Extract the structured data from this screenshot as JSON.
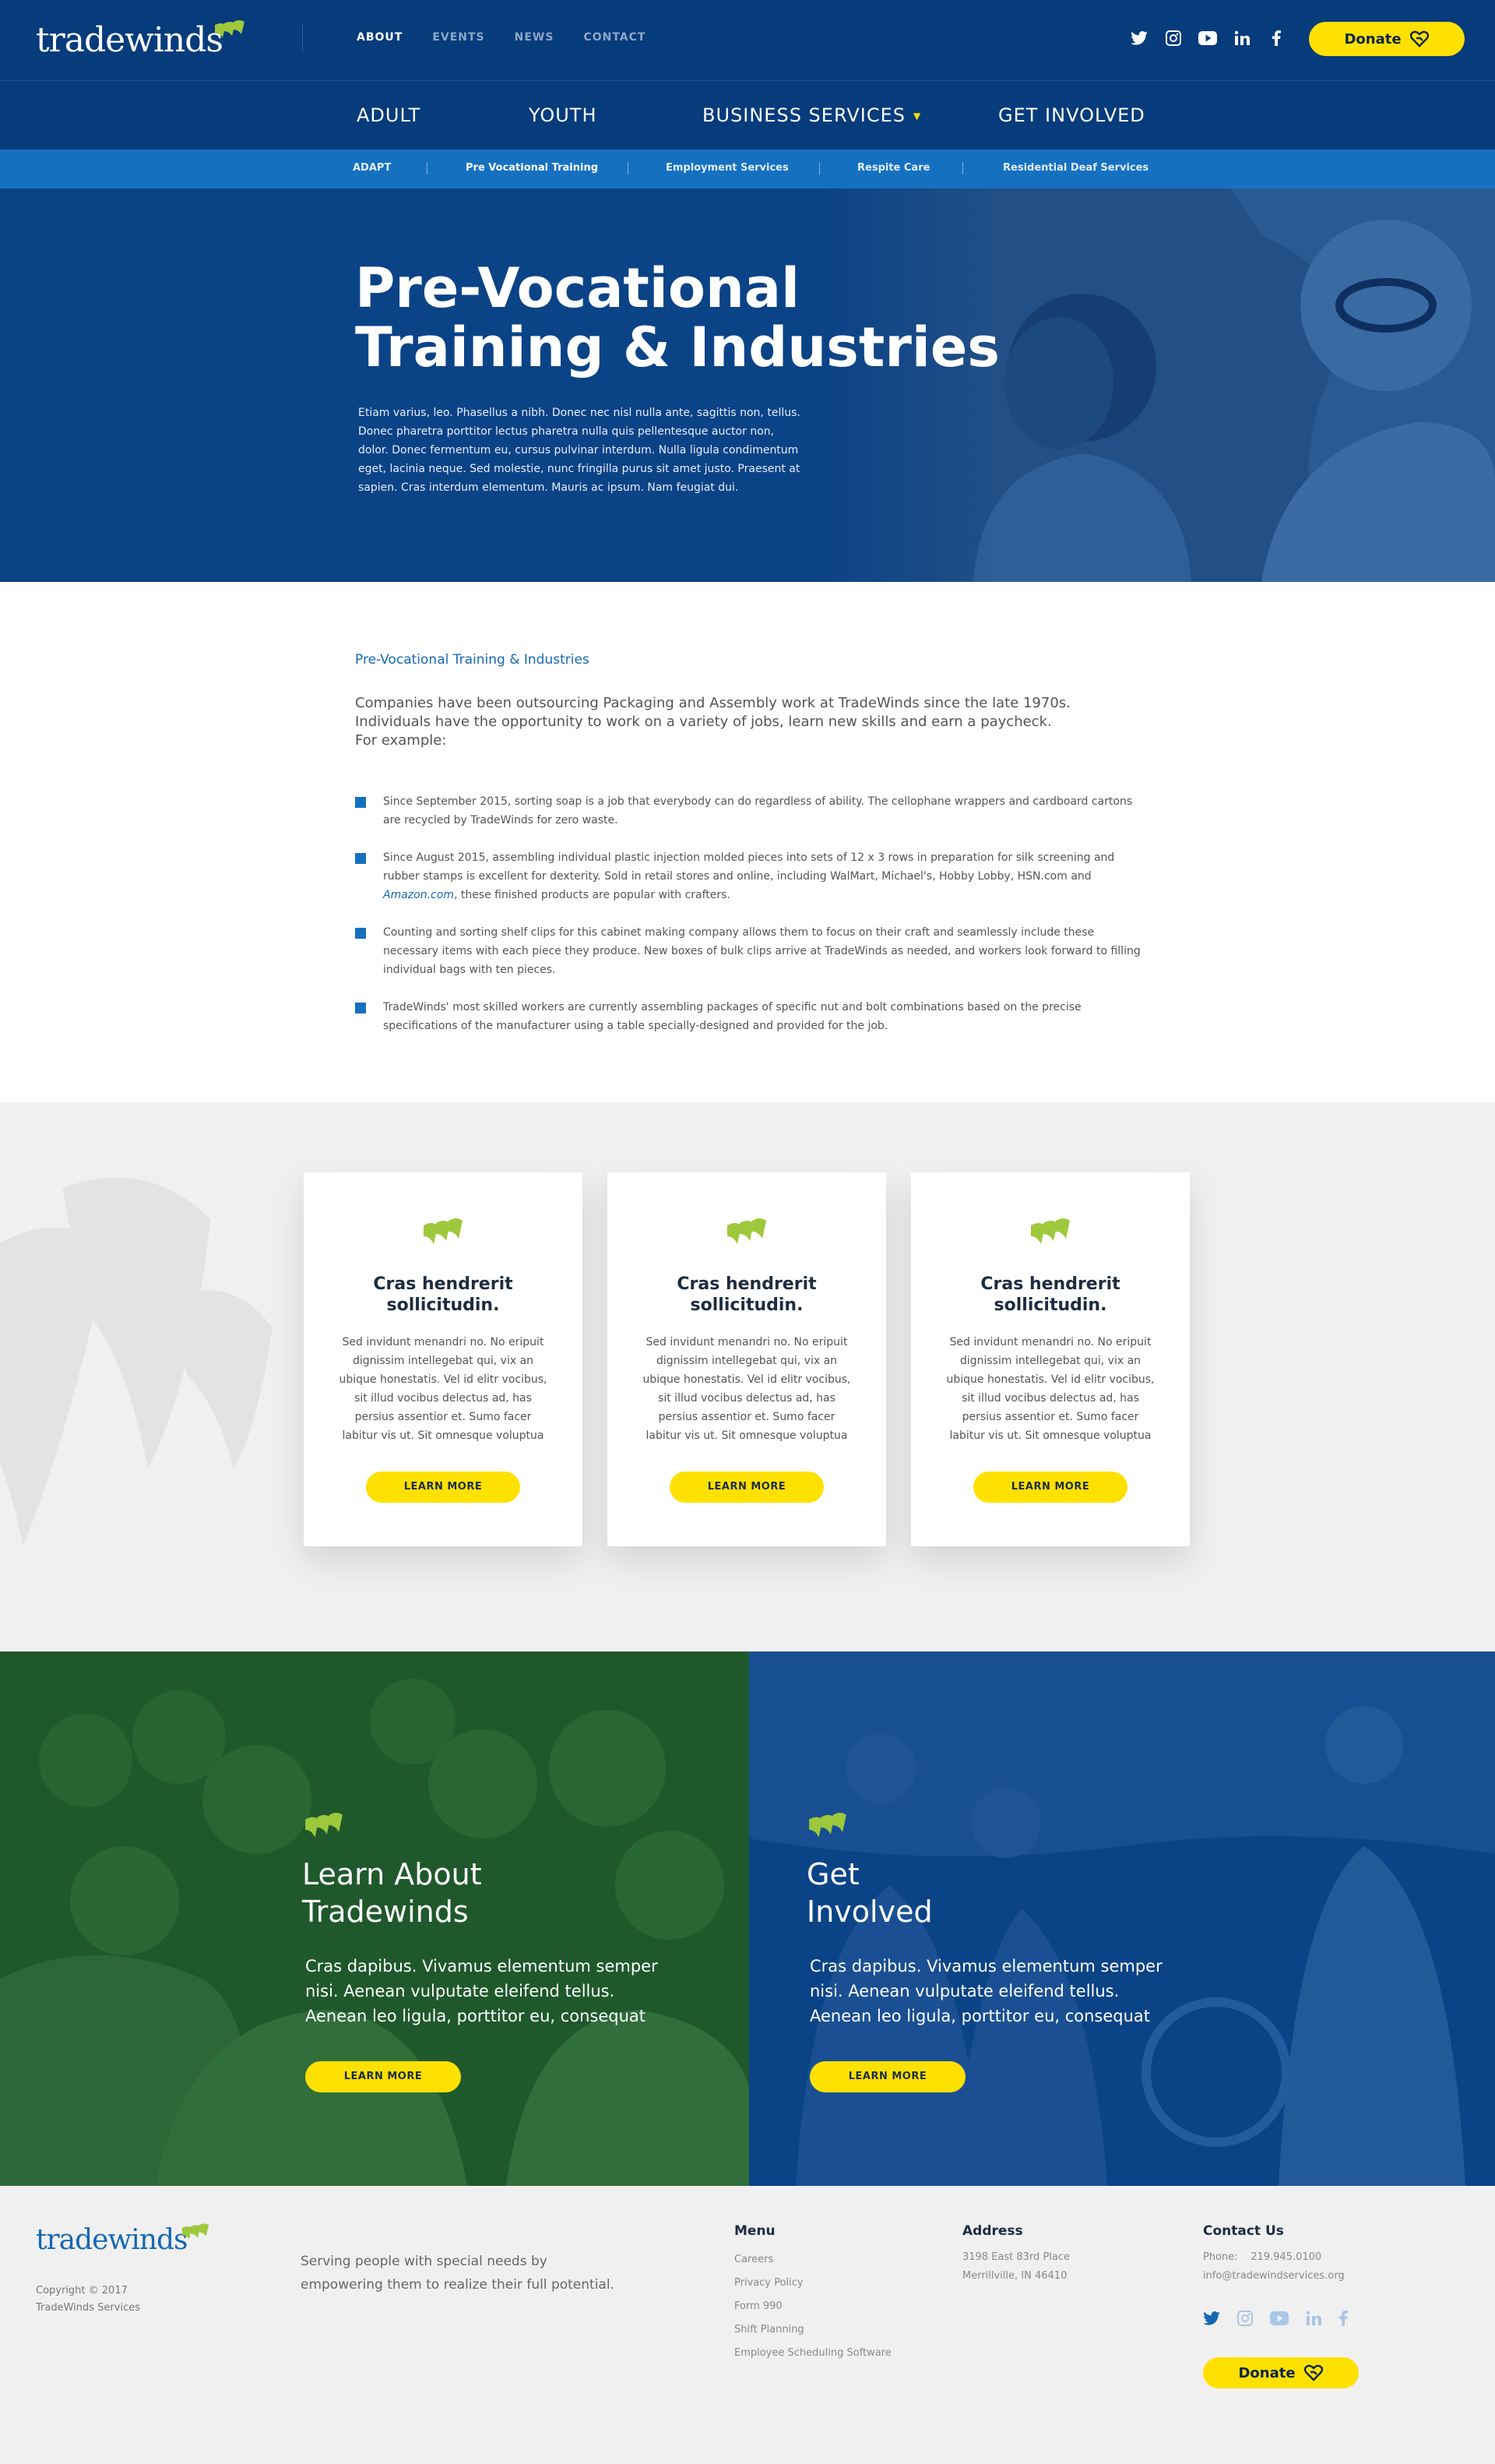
{
  "brand": {
    "logo_text": "tradewinds",
    "accent_yellow": "#ffe100",
    "brand_blue": "#063b7c",
    "brand_green": "#9ec83c"
  },
  "header": {
    "top_nav": [
      "ABOUT",
      "EVENTS",
      "NEWS",
      "CONTACT"
    ],
    "active_top_nav": "ABOUT",
    "social_icons": [
      "twitter-icon",
      "instagram-icon",
      "youtube-icon",
      "linkedin-icon",
      "facebook-icon"
    ],
    "donate_label": "Donate",
    "main_nav": [
      "ADULT",
      "YOUTH",
      "BUSINESS SERVICES",
      "GET INVOLVED"
    ],
    "sub_nav": [
      "ADAPT",
      "Pre Vocational Training",
      "Employment Services",
      "Respite Care",
      "Residential Deaf Services"
    ],
    "active_sub_nav": "Pre Vocational Training"
  },
  "hero": {
    "title": "Pre-Vocational\nTraining & Industries",
    "text": "Etiam varius, leo. Phasellus a nibh. Donec nec nisl nulla ante, sagittis non, tellus. Donec pharetra porttitor lectus pharetra nulla quis pellentesque auctor non, dolor. Donec fermentum eu, cursus pulvinar interdum. Nulla ligula condimentum eget, lacinia neque. Sed molestie, nunc fringilla purus sit amet justo. Praesent at sapien. Cras interdum elementum. Mauris ac ipsum. Nam feugiat dui."
  },
  "content": {
    "kicker": "Pre-Vocational Training & Industries",
    "intro": "Companies have been outsourcing Packaging and Assembly work at TradeWinds since the late 1970s. Individuals have the opportunity to work on a variety of jobs, learn new skills and earn a paycheck.",
    "intro_tail": "For example:",
    "bullets": [
      "Since September 2015, sorting soap is a job that everybody can do regardless of ability. The cellophane wrappers and cardboard cartons are recycled by TradeWinds for zero waste.",
      "Since August 2015, assembling individual plastic injection molded pieces into sets of 12 x 3 rows in preparation for silk screening and rubber stamps is excellent for dexterity. Sold in retail stores and online, including WalMart, Michael's, Hobby Lobby, HSN.com and",
      "Counting and sorting shelf clips for this cabinet making company allows them to focus on their craft and seamlessly include these necessary items with each piece they produce. New boxes of bulk clips arrive at TradeWinds as needed, and workers look forward to filling individual bags with ten pieces.",
      "TradeWinds' most skilled workers are currently assembling packages of specific nut and bolt combinations based on the precise specifications of the manufacturer using a table specially-designed and provided for the job."
    ],
    "bullet2_link": "Amazon.com",
    "bullet2_tail": ", these finished products are popular with crafters."
  },
  "cards": [
    {
      "title": "Cras hendrerit sollicitudin.",
      "text": "Sed invidunt menandri no. No eripuit dignissim intellegebat qui, vix an ubique honestatis. Vel id elitr vocibus, sit illud vocibus delectus ad, has persius assentior et. Sumo facer labitur vis ut. Sit omnesque voluptua",
      "button": "LEARN MORE"
    },
    {
      "title": "Cras hendrerit sollicitudin.",
      "text": "Sed invidunt menandri no. No eripuit dignissim intellegebat qui, vix an ubique honestatis. Vel id elitr vocibus, sit illud vocibus delectus ad, has persius assentior et. Sumo facer labitur vis ut. Sit omnesque voluptua",
      "button": "LEARN MORE"
    },
    {
      "title": "Cras hendrerit sollicitudin.",
      "text": "Sed invidunt menandri no. No eripuit dignissim intellegebat qui, vix an ubique honestatis. Vel id elitr vocibus, sit illud vocibus delectus ad, has persius assentior et. Sumo facer labitur vis ut. Sit omnesque voluptua",
      "button": "LEARN MORE"
    }
  ],
  "cta": {
    "learn": {
      "title": "Learn About\nTradewinds",
      "text": "Cras dapibus. Vivamus elementum semper nisi. Aenean vulputate eleifend tellus. Aenean leo ligula, porttitor eu, consequat",
      "button": "LEARN MORE"
    },
    "involved": {
      "title": "Get\nInvolved",
      "text": "Cras dapibus. Vivamus elementum semper nisi. Aenean vulputate eleifend tellus. Aenean leo ligula, porttitor eu, consequat",
      "button": "LEARN MORE"
    }
  },
  "footer": {
    "logo_text": "tradewinds",
    "copyright": "Copyright © 2017\nTradeWinds Services",
    "tagline": "Serving people with special needs by empowering them to realize their full potential.",
    "menu_heading": "Menu",
    "menu": [
      "Careers",
      "Privacy Policy",
      "Form 990",
      "Shift Planning",
      "Employee Scheduling Software"
    ],
    "address_heading": "Address",
    "address_line1": "3198 East 83rd Place",
    "address_line2": "Merrillville, IN 46410",
    "contact_heading": "Contact Us",
    "phone_label": "Phone:",
    "phone": "219.945.0100",
    "email": "info@tradewindservices.org",
    "donate_label": "Donate"
  }
}
